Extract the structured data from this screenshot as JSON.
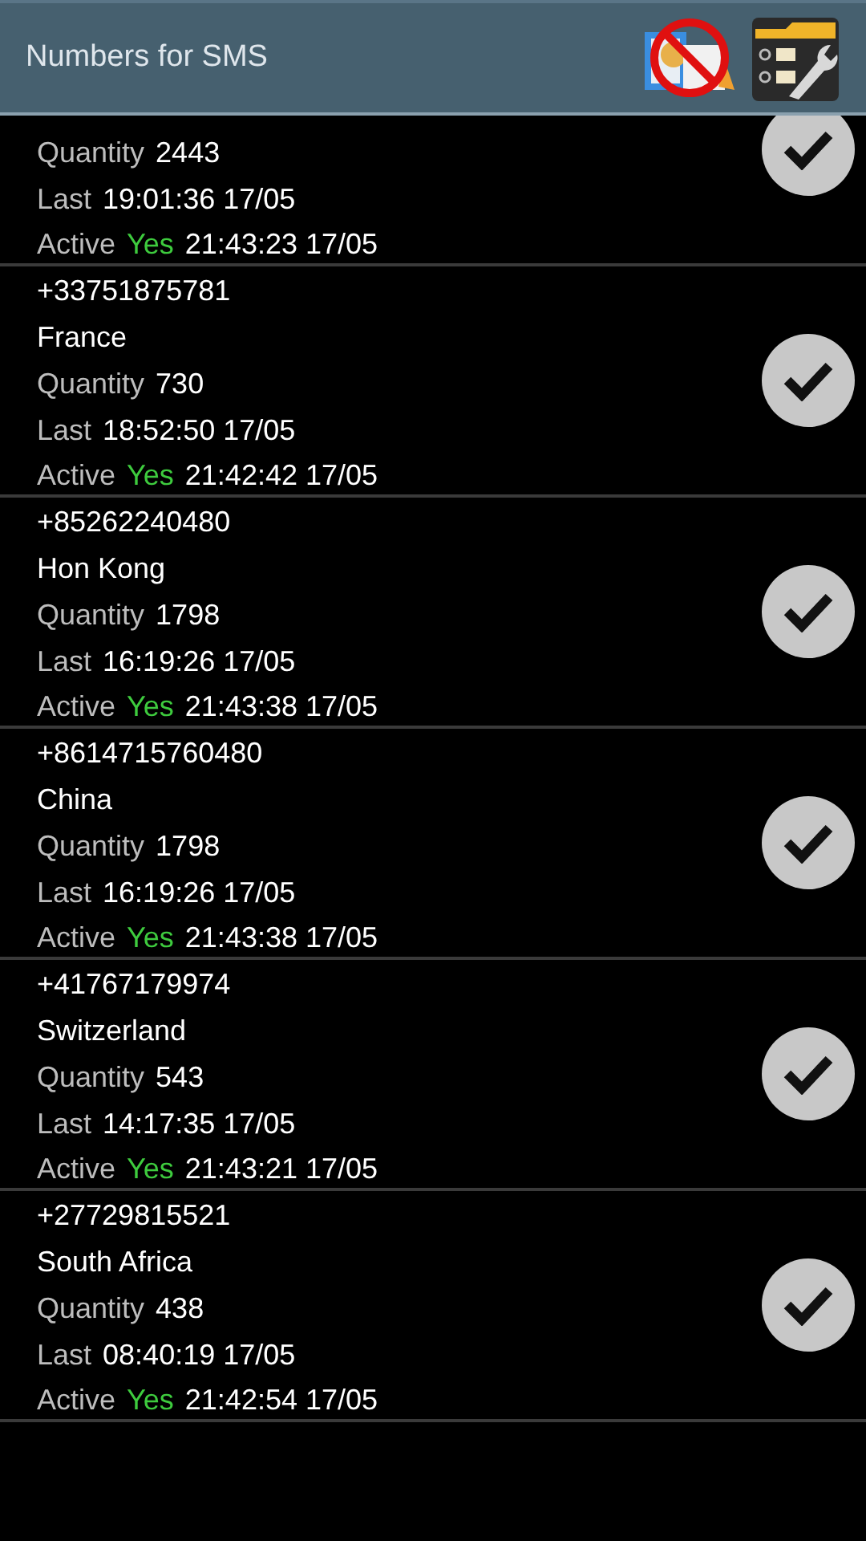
{
  "title": "Numbers for SMS",
  "rows": [
    {
      "quantity_label": "Quantity",
      "quantity": "2443",
      "last_label": "Last",
      "last": "19:01:36 17/05",
      "active_label": "Active",
      "active": true,
      "active_value": "Yes",
      "active_time": "21:43:23 17/05",
      "checked": true
    },
    {
      "number": "+33751875781",
      "country": "France",
      "quantity_label": "Quantity",
      "quantity": "730",
      "last_label": "Last",
      "last": "18:52:50 17/05",
      "active_label": "Active",
      "active": true,
      "active_value": "Yes",
      "active_time": "21:42:42 17/05",
      "checked": true
    },
    {
      "number": "+85262240480",
      "country": "Hon Kong",
      "quantity_label": "Quantity",
      "quantity": "1798",
      "last_label": "Last",
      "last": "16:19:26 17/05",
      "active_label": "Active",
      "active": true,
      "active_value": "Yes",
      "active_time": "21:43:38 17/05",
      "checked": true
    },
    {
      "number": "+8614715760480",
      "country": "China",
      "quantity_label": "Quantity",
      "quantity": "1798",
      "last_label": "Last",
      "last": "16:19:26 17/05",
      "active_label": "Active",
      "active": true,
      "active_value": "Yes",
      "active_time": "21:43:38 17/05",
      "checked": true
    },
    {
      "number": "+41767179974",
      "country": "Switzerland",
      "quantity_label": "Quantity",
      "quantity": "543",
      "last_label": "Last",
      "last": "14:17:35 17/05",
      "active_label": "Active",
      "active": true,
      "active_value": "Yes",
      "active_time": "21:43:21 17/05",
      "checked": true
    },
    {
      "number": "+27729815521",
      "country": "South Africa",
      "quantity_label": "Quantity",
      "quantity": "438",
      "last_label": "Last",
      "last": "08:40:19 17/05",
      "active_label": "Active",
      "active": true,
      "active_value": "Yes",
      "active_time": "21:42:54 17/05",
      "checked": true
    }
  ]
}
